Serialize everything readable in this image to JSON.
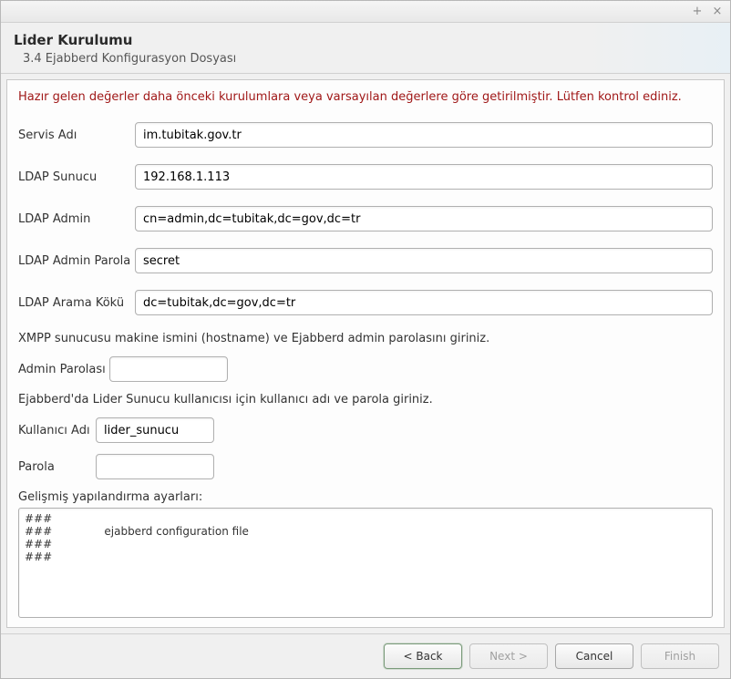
{
  "header": {
    "title": "Lider Kurulumu",
    "subtitle": "3.4 Ejabberd Konfigurasyon Dosyası"
  },
  "warning": "Hazır gelen değerler daha önceki kurulumlara veya varsayılan değerlere göre getirilmiştir. Lütfen kontrol ediniz.",
  "form": {
    "service_name_label": "Servis Adı",
    "service_name_value": "im.tubitak.gov.tr",
    "ldap_server_label": "LDAP Sunucu",
    "ldap_server_value": "192.168.1.113",
    "ldap_admin_label": "LDAP Admin",
    "ldap_admin_value": "cn=admin,dc=tubitak,dc=gov,dc=tr",
    "ldap_admin_pass_label": "LDAP Admin Parola",
    "ldap_admin_pass_value": "secret",
    "ldap_search_root_label": "LDAP Arama Kökü",
    "ldap_search_root_value": "dc=tubitak,dc=gov,dc=tr",
    "xmpp_note": "XMPP sunucusu makine ismini (hostname) ve Ejabberd admin parolasını giriniz.",
    "admin_pass_label": "Admin Parolası",
    "admin_pass_value": "",
    "lider_note": "Ejabberd'da Lider Sunucu kullanıcısı için kullanıcı adı ve parola giriniz.",
    "username_label": "Kullanıcı Adı",
    "username_value": "lider_sunucu",
    "password_label": "Parola",
    "password_value": "",
    "advanced_label": "Gelişmiş yapılandırma ayarları:",
    "config_text": "###\n###               ejabberd configuration file\n###\n###"
  },
  "buttons": {
    "back": "< Back",
    "next": "Next >",
    "cancel": "Cancel",
    "finish": "Finish"
  }
}
